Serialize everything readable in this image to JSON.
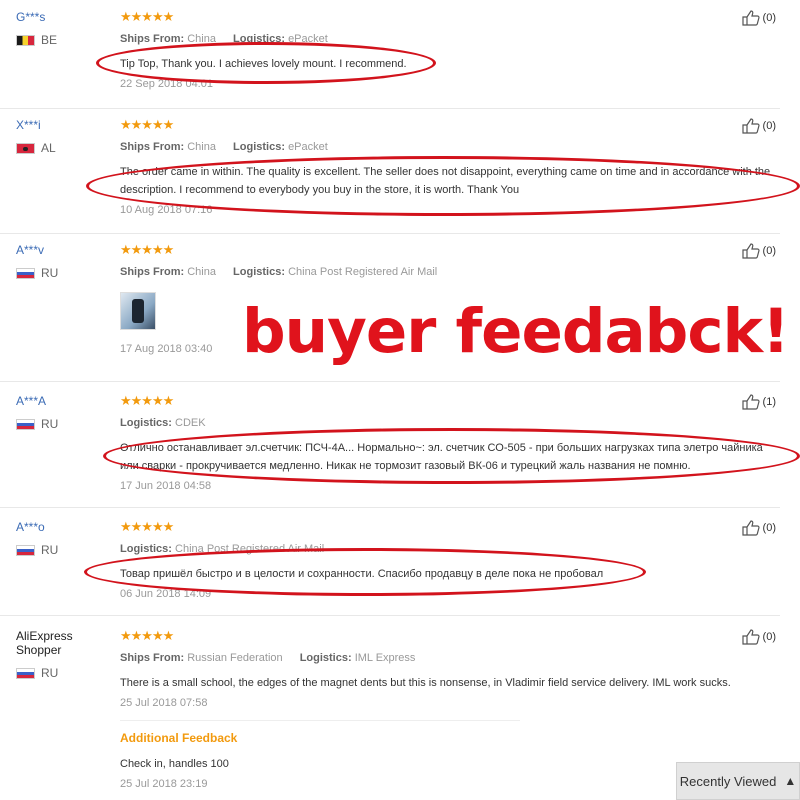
{
  "reviews": [
    {
      "user": "G***s",
      "country": "BE",
      "stars": "★★★★★",
      "ships_label": "Ships From:",
      "ships_value": "China",
      "logistics_label": "Logistics:",
      "logistics_value": "ePacket",
      "text": "Tip Top, Thank you. I achieves lovely mount. I recommend.",
      "date": "22 Sep 2018 04:01",
      "likes": "(0)"
    },
    {
      "user": "X***i",
      "country": "AL",
      "stars": "★★★★★",
      "ships_label": "Ships From:",
      "ships_value": "China",
      "logistics_label": "Logistics:",
      "logistics_value": "ePacket",
      "text": "The order came in within. The quality is excellent. The seller does not disappoint, everything came on time and in accordance with the description. I recommend to everybody you buy in the store, it is worth. Thank You",
      "date": "10 Aug 2018 07:16",
      "likes": "(0)"
    },
    {
      "user": "A***v",
      "country": "RU",
      "stars": "★★★★★",
      "ships_label": "Ships From:",
      "ships_value": "China",
      "logistics_label": "Logistics:",
      "logistics_value": "China Post Registered Air Mail",
      "date": "17 Aug 2018 03:40",
      "likes": "(0)"
    },
    {
      "user": "A***A",
      "country": "RU",
      "stars": "★★★★★",
      "logistics_label": "Logistics:",
      "logistics_value": "CDEK",
      "text": "Отлично останавливает эл.счетчик: ПСЧ-4А... Нормально~: эл. счетчик СО-505 - при больших нагрузках типа элетро чайника или сварки - прокручивается медленно. Никак не тормозит газовый ВК-06 и турецкий жаль названия не помню.",
      "date": "17 Jun 2018 04:58",
      "likes": "(1)"
    },
    {
      "user": "A***o",
      "country": "RU",
      "stars": "★★★★★",
      "logistics_label": "Logistics:",
      "logistics_value": "China Post Registered Air Mail",
      "text": "Товар пришёл быстро и в целости и сохранности. Спасибо продавцу в деле пока не пробовал",
      "date": "06 Jun 2018 14:09",
      "likes": "(0)"
    },
    {
      "user": "AliExpress Shopper",
      "country": "RU",
      "stars": "★★★★★",
      "ships_label": "Ships From:",
      "ships_value": "Russian Federation",
      "logistics_label": "Logistics:",
      "logistics_value": "IML Express",
      "text": "There is a small school, the edges of the magnet dents but this is nonsense, in Vladimir field service delivery. IML work sucks.",
      "date": "25 Jul 2018 07:58",
      "additional_label": "Additional Feedback",
      "additional_text": "Check in, handles 100",
      "additional_date": "25 Jul 2018 23:19",
      "likes": "(0)"
    }
  ],
  "overlay_text": "buyer feedabck!",
  "recently_viewed": "Recently Viewed",
  "colors": {
    "stars": "#f29a0e",
    "annotation_red": "#d2131c",
    "username": "#3b6bb5"
  },
  "icons": {
    "like": "thumbs-up-icon",
    "chevron": "chevron-up-icon",
    "photo": "review-photo"
  }
}
